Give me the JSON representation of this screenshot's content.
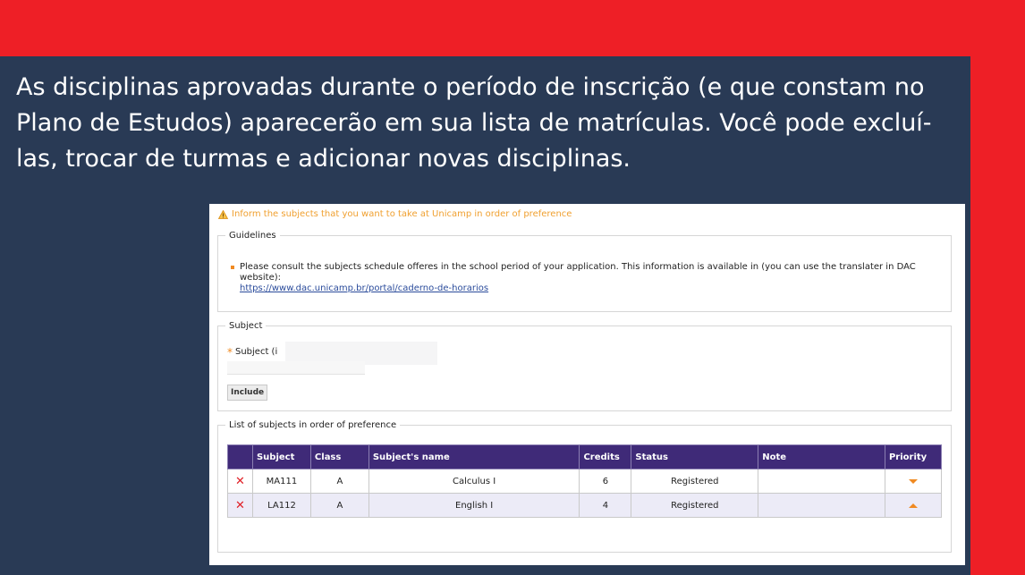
{
  "slide": {
    "heading": "As disciplinas aprovadas durante o período de inscrição (e que constam no Plano de Estudos) aparecerão em sua lista de matrículas. Você pode excluí-las, trocar de turmas e adicionar novas disciplinas."
  },
  "form": {
    "warning": "Inform the subjects that you want to take at Unicamp in order of preference",
    "guidelines": {
      "legend": "Guidelines",
      "text": "Please consult the subjects schedule offeres in the school period of your application. This information is available in (you can use the translater in DAC website):",
      "link": "https://www.dac.unicamp.br/portal/caderno-de-horarios"
    },
    "subject": {
      "legend": "Subject",
      "required_mark": "*",
      "label": "Subject (i",
      "include_button": "Include"
    },
    "list": {
      "legend": "List of subjects in order of preference",
      "headers": [
        "",
        "Subject",
        "Class",
        "Subject's name",
        "Credits",
        "Status",
        "Note",
        "Priority"
      ],
      "rows": [
        {
          "code": "MA111",
          "class": "A",
          "name": "Calculus I",
          "credits": "6",
          "status": "Registered",
          "note": "",
          "priority": "down"
        },
        {
          "code": "LA112",
          "class": "A",
          "name": "English I",
          "credits": "4",
          "status": "Registered",
          "note": "",
          "priority": "up"
        }
      ]
    }
  },
  "colors": {
    "background_red": "#ee1f26",
    "panel_navy": "#293a55",
    "table_header": "#3f2a78",
    "accent_orange": "#f08a22"
  }
}
